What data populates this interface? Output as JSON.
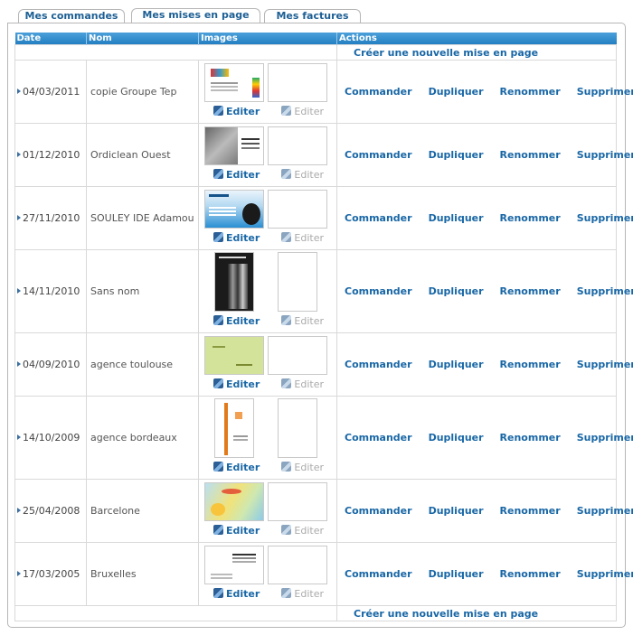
{
  "tabs": [
    "Mes commandes",
    "Mes mises en page",
    "Mes factures"
  ],
  "active_tab": 1,
  "table": {
    "headers": {
      "date": "Date",
      "name": "Nom",
      "images": "Images",
      "actions": "Actions"
    },
    "create_label": "Créer une nouvelle mise en page",
    "edit_label": "Editer",
    "actions": [
      "Commander",
      "Dupliquer",
      "Renommer",
      "Supprimer"
    ],
    "rows": [
      {
        "date": "04/03/2011",
        "name": "copie Groupe Tep"
      },
      {
        "date": "01/12/2010",
        "name": "Ordiclean Ouest"
      },
      {
        "date": "27/11/2010",
        "name": "SOULEY IDE Adamou"
      },
      {
        "date": "14/11/2010",
        "name": "Sans nom"
      },
      {
        "date": "04/09/2010",
        "name": "agence toulouse"
      },
      {
        "date": "14/10/2009",
        "name": "agence bordeaux"
      },
      {
        "date": "25/04/2008",
        "name": "Barcelone"
      },
      {
        "date": "17/03/2005",
        "name": "Bruxelles"
      }
    ]
  },
  "colors": {
    "accent": "#1967a6",
    "header_bg": "#237fc2",
    "border": "#d9d9d9"
  }
}
